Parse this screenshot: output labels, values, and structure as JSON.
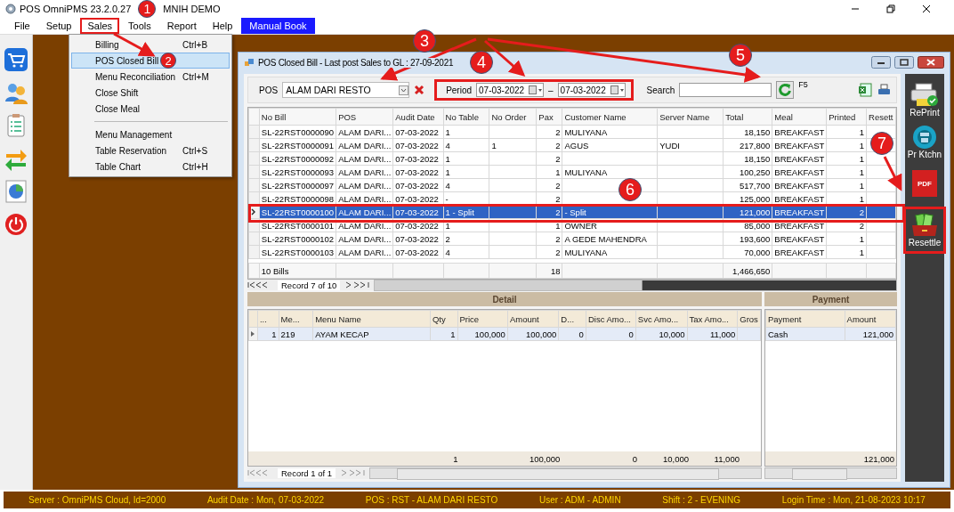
{
  "window": {
    "title_parts": [
      "POS OmniPMS 23.2.0.27",
      "MNIH DEMO"
    ]
  },
  "menu_bar": [
    {
      "label": "File",
      "kind": "menu",
      "selected": false
    },
    {
      "label": "Setup",
      "kind": "menu",
      "selected": false
    },
    {
      "label": "Sales",
      "kind": "menu",
      "selected": true
    },
    {
      "label": "Tools",
      "kind": "menu",
      "selected": false
    },
    {
      "label": "Report",
      "kind": "menu",
      "selected": false
    },
    {
      "label": "Help",
      "kind": "menu",
      "selected": false
    },
    {
      "label": "Manual Book",
      "kind": "link",
      "selected": false
    }
  ],
  "sales_menu": [
    [
      {
        "label": "Billing",
        "shortcut": "Ctrl+B",
        "selected": false
      },
      {
        "label": "POS Closed Bill",
        "selected": true
      },
      {
        "label": "Menu Reconciliation",
        "shortcut": "Ctrl+M",
        "selected": false
      },
      {
        "label": "Close Shift",
        "selected": false
      },
      {
        "label": "Close Meal",
        "selected": false
      }
    ],
    [
      {
        "label": "Menu Management",
        "selected": false
      },
      {
        "label": "Table Reservation",
        "shortcut": "Ctrl+S",
        "selected": false
      },
      {
        "label": "Table Chart",
        "shortcut": "Ctrl+H",
        "selected": false
      }
    ]
  ],
  "child_window": {
    "title": "POS Closed Bill - Last post Sales to GL : 27-09-2021",
    "filter": {
      "pos_label": "POS",
      "pos_value": "ALAM DARI RESTO",
      "period_label": "Period",
      "period_from": "07-03-2022",
      "period_separator": "–",
      "period_to": "07-03-2022",
      "search_label": "Search",
      "refresh_shortcut": "F5"
    },
    "bills": {
      "columns": [
        "No Bill",
        "POS",
        "Audit Date",
        "No Table",
        "No Order",
        "Pax",
        "Customer Name",
        "Server Name",
        "Total",
        "Meal",
        "Printed",
        "Resett"
      ],
      "rows": [
        {
          "no_bill": "SL-22RST0000090",
          "pos": "ALAM DARI...",
          "audit_date": "07-03-2022",
          "no_table": "1",
          "pax": "2",
          "customer_name": "MULIYANA",
          "total": "18,150",
          "meal": "BREAKFAST",
          "printed": "1",
          "selected": false
        },
        {
          "no_bill": "SL-22RST0000091",
          "pos": "ALAM DARI...",
          "audit_date": "07-03-2022",
          "no_table": "4",
          "no_order": "1",
          "pax": "2",
          "customer_name": "AGUS",
          "server_name": "YUDI",
          "total": "217,800",
          "meal": "BREAKFAST",
          "printed": "1",
          "selected": false
        },
        {
          "no_bill": "SL-22RST0000092",
          "pos": "ALAM DARI...",
          "audit_date": "07-03-2022",
          "no_table": "1",
          "pax": "2",
          "total": "18,150",
          "meal": "BREAKFAST",
          "printed": "1",
          "selected": false
        },
        {
          "no_bill": "SL-22RST0000093",
          "pos": "ALAM DARI...",
          "audit_date": "07-03-2022",
          "no_table": "1",
          "pax": "1",
          "customer_name": "MULIYANA",
          "total": "100,250",
          "meal": "BREAKFAST",
          "printed": "1",
          "selected": false
        },
        {
          "no_bill": "SL-22RST0000097",
          "pos": "ALAM DARI...",
          "audit_date": "07-03-2022",
          "no_table": "4",
          "pax": "2",
          "total": "517,700",
          "meal": "BREAKFAST",
          "printed": "1",
          "selected": false
        },
        {
          "no_bill": "SL-22RST0000098",
          "pos": "ALAM DARI...",
          "audit_date": "07-03-2022",
          "no_table": "-",
          "pax": "2",
          "total": "125,000",
          "meal": "BREAKFAST",
          "printed": "1",
          "selected": false
        },
        {
          "no_bill": "SL-22RST0000100",
          "pos": "ALAM DARI...",
          "audit_date": "07-03-2022",
          "no_table": "1 - Split",
          "pax": "2",
          "customer_name": "- Split",
          "total": "121,000",
          "meal": "BREAKFAST",
          "printed": "2",
          "selected": true
        },
        {
          "no_bill": "SL-22RST0000101",
          "pos": "ALAM DARI...",
          "audit_date": "07-03-2022",
          "no_table": "1",
          "pax": "1",
          "customer_name": "OWNER",
          "total": "85,000",
          "meal": "BREAKFAST",
          "printed": "2",
          "selected": false
        },
        {
          "no_bill": "SL-22RST0000102",
          "pos": "ALAM DARI...",
          "audit_date": "07-03-2022",
          "no_table": "2",
          "pax": "2",
          "customer_name": "A GEDE MAHENDRA",
          "total": "193,600",
          "meal": "BREAKFAST",
          "printed": "1",
          "selected": false
        },
        {
          "no_bill": "SL-22RST0000103",
          "pos": "ALAM DARI...",
          "audit_date": "07-03-2022",
          "no_table": "4",
          "pax": "2",
          "customer_name": "MULIYANA",
          "total": "70,000",
          "meal": "BREAKFAST",
          "printed": "1",
          "selected": false
        }
      ],
      "footer": {
        "bill_count": "10 Bills",
        "pax": "18",
        "total": "1,466,650"
      },
      "navigator": "Record 7 of 10"
    },
    "detail": {
      "title": "Detail",
      "columns": [
        "...",
        "Me...",
        "Menu Name",
        "Qty",
        "Price",
        "Amount",
        "D...",
        "Disc Amo...",
        "Svc Amo...",
        "Tax Amo...",
        "Gros"
      ],
      "rows": [
        {
          "no": "1",
          "menu_code": "219",
          "menu_name": "AYAM KECAP",
          "qty": "1",
          "price": "100,000",
          "amount": "100,000",
          "disc_pct": "0",
          "disc_amount": "0",
          "svc_amount": "10,000",
          "tax_amount": "11,000",
          "selected": true
        }
      ],
      "totals": {
        "qty": "1",
        "amount": "100,000",
        "disc_amount": "0",
        "svc_amount": "10,000",
        "tax_amount": "11,000"
      },
      "navigator": "Record 1 of 1"
    },
    "payment": {
      "title": "Payment",
      "columns": [
        "Payment",
        "Amount"
      ],
      "rows": [
        {
          "payment": "Cash",
          "amount": "121,000",
          "selected": true
        }
      ],
      "totals": {
        "amount": "121,000"
      }
    }
  },
  "side_panel": [
    {
      "kind": "reprint",
      "label": "RePrint"
    },
    {
      "kind": "kitchen",
      "label": "Pr Ktchn"
    },
    {
      "kind": "pdf",
      "icon_text": "PDF"
    },
    {
      "kind": "resettle",
      "label": "Resettle"
    }
  ],
  "status_bar": [
    "Server : OmniPMS Cloud, Id=2000",
    "Audit Date : Mon, 07-03-2022",
    "POS : RST - ALAM DARI RESTO",
    "User : ADM - ADMIN",
    "Shift : 2 - EVENING",
    "Login Time : Mon, 21-08-2023 10:17"
  ],
  "callouts": [
    "1",
    "2",
    "3",
    "4",
    "5",
    "6",
    "7"
  ]
}
